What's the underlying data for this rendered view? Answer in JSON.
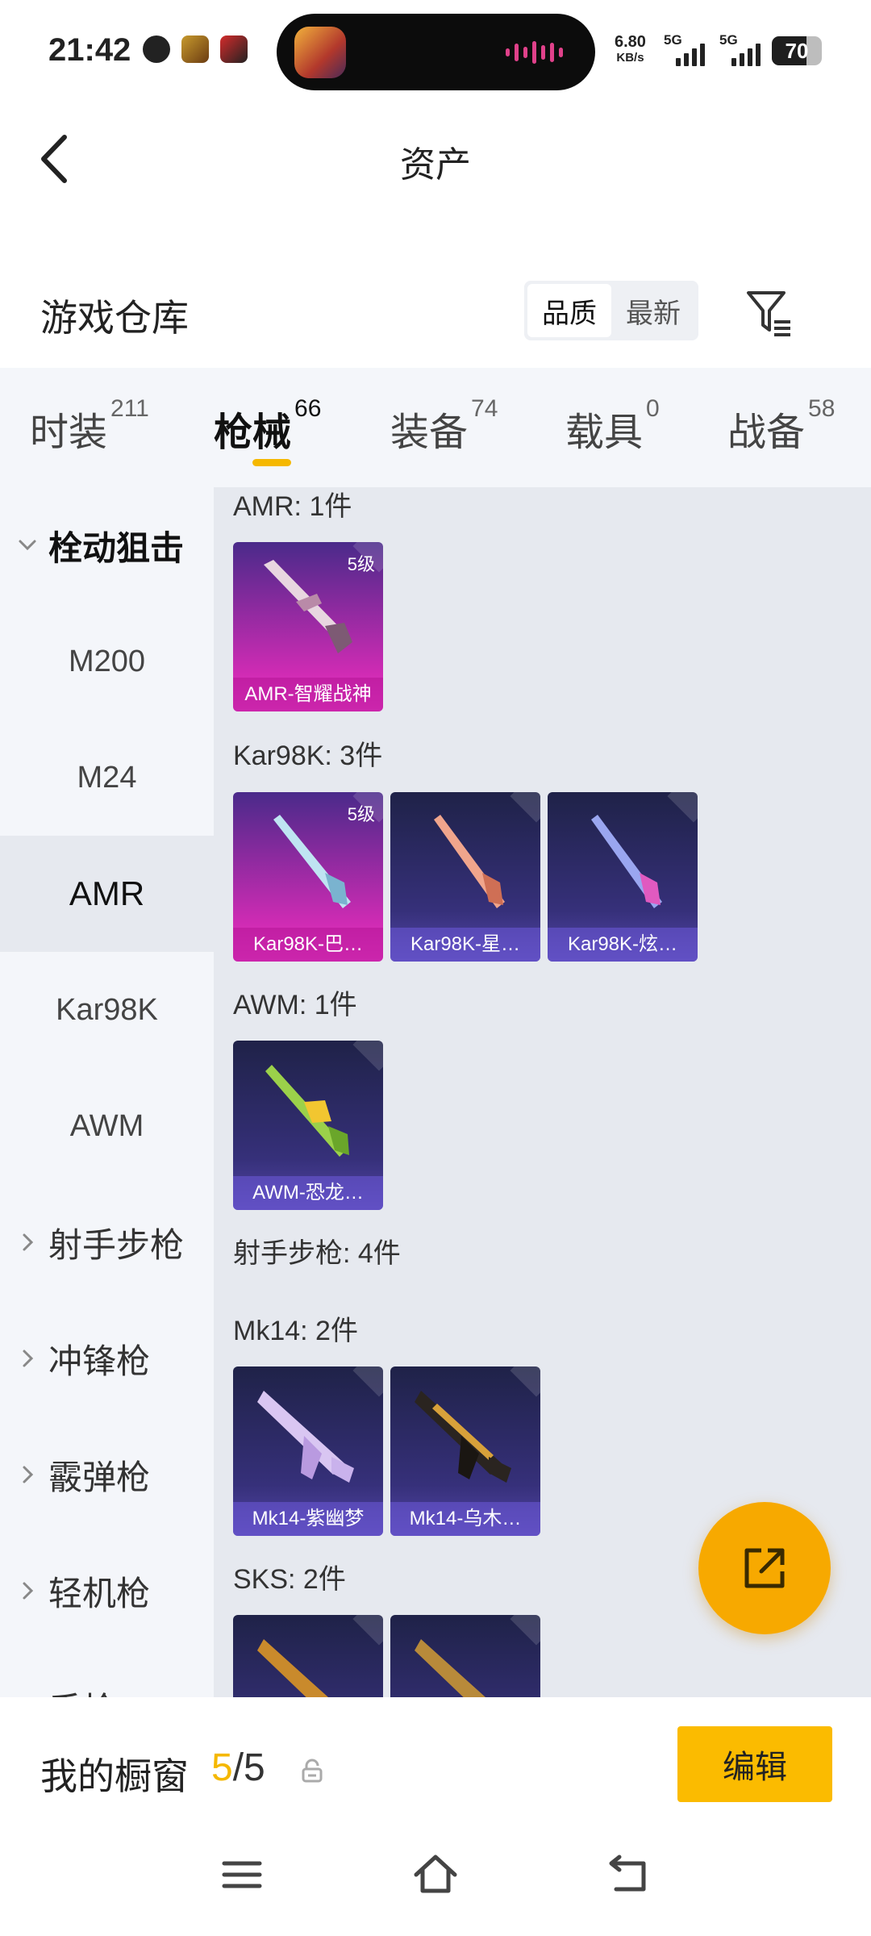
{
  "status_bar": {
    "time": "21:42",
    "net_speed": "6.80",
    "net_speed_unit": "KB/s",
    "sim1": "5G",
    "sim2": "5G",
    "battery": "70",
    "battery_fraction": 0.7
  },
  "header": {
    "title": "资产"
  },
  "warehouse": {
    "title": "游戏仓库",
    "sort_options": [
      "品质",
      "最新"
    ],
    "sort_active": "品质"
  },
  "tabs": [
    {
      "label": "时装",
      "count": "211"
    },
    {
      "label": "枪械",
      "count": "66"
    },
    {
      "label": "装备",
      "count": "74"
    },
    {
      "label": "载具",
      "count": "0"
    },
    {
      "label": "战备",
      "count": "58"
    }
  ],
  "sidebar": {
    "group_open": "栓动狙击",
    "items": [
      "M200",
      "M24",
      "AMR",
      "Kar98K",
      "AWM"
    ],
    "selected": "AMR",
    "groups_collapsed": [
      "射手步枪",
      "冲锋枪",
      "霰弹枪",
      "轻机枪"
    ],
    "partial_next": "手枪"
  },
  "content": {
    "sections": [
      {
        "label": "AMR: 1件"
      },
      {
        "label": "Kar98K: 3件"
      },
      {
        "label": "AWM: 1件"
      },
      {
        "label": "射手步枪: 4件"
      },
      {
        "label": "Mk14: 2件"
      },
      {
        "label": "SKS: 2件"
      }
    ],
    "cards": {
      "amr": [
        {
          "name": "AMR-智耀战神",
          "level": "5级",
          "tier": "purple"
        }
      ],
      "kar98k": [
        {
          "name": "Kar98K-巴…",
          "level": "5级",
          "tier": "purple"
        },
        {
          "name": "Kar98K-星…",
          "tier": "blue"
        },
        {
          "name": "Kar98K-炫…",
          "tier": "blue"
        }
      ],
      "awm": [
        {
          "name": "AWM-恐龙…",
          "tier": "blue"
        }
      ],
      "mk14": [
        {
          "name": "Mk14-紫幽梦",
          "tier": "blue"
        },
        {
          "name": "Mk14-乌木…",
          "tier": "blue"
        }
      ],
      "sks": [
        {
          "name": "",
          "tier": "blue"
        },
        {
          "name": "",
          "tier": "blue"
        }
      ]
    }
  },
  "showcase": {
    "title": "我的橱窗",
    "current": "5",
    "separator": "/",
    "total": "5",
    "edit_label": "编辑"
  },
  "colors": {
    "accent": "#f5b800",
    "fab": "#f7a900",
    "sidebar_bg": "#f4f6fa",
    "content_bg": "#e6e9ef",
    "tier_purple": "#d02bb4",
    "tier_blue": "#36307a"
  },
  "icons": {
    "back": "chevron-left-icon",
    "filter": "filter-icon",
    "share": "share-external-icon",
    "lock": "lock-icon",
    "nav_menu": "menu-icon",
    "nav_home": "home-icon",
    "nav_back": "back-icon"
  }
}
